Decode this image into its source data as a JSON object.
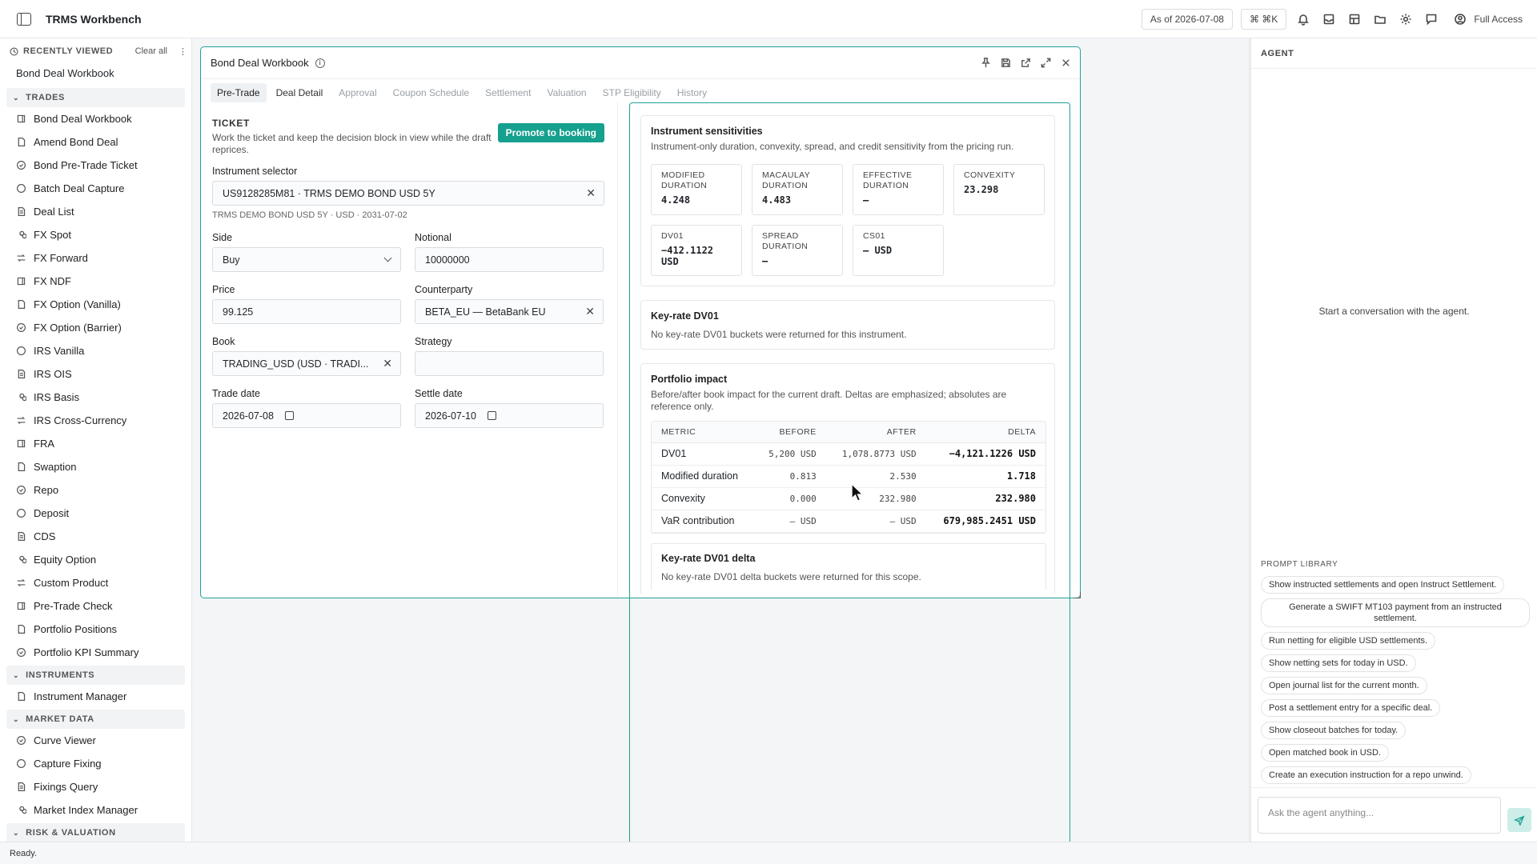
{
  "app": {
    "title": "TRMS Workbench"
  },
  "topbar": {
    "as_of": "As of 2026-07-08",
    "shortcut": "⌘ ⌘K",
    "access": "Full Access"
  },
  "sidebar": {
    "recent_label": "RECENTLY VIEWED",
    "clear_all": "Clear all",
    "recent_items": [
      "Bond Deal Workbook"
    ],
    "sections": [
      {
        "label": "TRADES",
        "items": [
          "Bond Deal Workbook",
          "Amend Bond Deal",
          "Bond Pre-Trade Ticket",
          "Batch Deal Capture",
          "Deal List",
          "FX Spot",
          "FX Forward",
          "FX NDF",
          "FX Option (Vanilla)",
          "FX Option (Barrier)",
          "IRS Vanilla",
          "IRS OIS",
          "IRS Basis",
          "IRS Cross-Currency",
          "FRA",
          "Swaption",
          "Repo",
          "Deposit",
          "CDS",
          "Equity Option",
          "Custom Product",
          "Pre-Trade Check",
          "Portfolio Positions",
          "Portfolio KPI Summary"
        ]
      },
      {
        "label": "INSTRUMENTS",
        "items": [
          "Instrument Manager"
        ]
      },
      {
        "label": "MARKET DATA",
        "items": [
          "Curve Viewer",
          "Capture Fixing",
          "Fixings Query",
          "Market Index Manager"
        ]
      },
      {
        "label": "RISK & VALUATION",
        "items": []
      }
    ]
  },
  "window": {
    "title": "Bond Deal Workbook",
    "tabs": [
      "Pre-Trade",
      "Deal Detail",
      "Approval",
      "Coupon Schedule",
      "Settlement",
      "Valuation",
      "STP Eligibility",
      "History"
    ]
  },
  "ticket": {
    "title": "TICKET",
    "desc": "Work the ticket and keep the decision block in view while the draft reprices.",
    "promote": "Promote to booking",
    "instrument_label": "Instrument selector",
    "instrument_value": "US9128285M81 · TRMS DEMO BOND USD 5Y",
    "instrument_hint": "TRMS DEMO BOND USD 5Y · USD · 2031-07-02",
    "side_label": "Side",
    "side_value": "Buy",
    "notional_label": "Notional",
    "notional_value": "10000000",
    "price_label": "Price",
    "price_value": "99.125",
    "counterparty_label": "Counterparty",
    "counterparty_value": "BETA_EU — BetaBank EU",
    "book_label": "Book",
    "book_value": "TRADING_USD (USD · TRADI...",
    "strategy_label": "Strategy",
    "strategy_value": "",
    "trade_date_label": "Trade date",
    "trade_date_value": "2026-07-08",
    "settle_date_label": "Settle date",
    "settle_date_value": "2026-07-10"
  },
  "sensitivities": {
    "title": "Instrument sensitivities",
    "sub": "Instrument-only duration, convexity, spread, and credit sensitivity from the pricing run.",
    "metrics": [
      {
        "label": "MODIFIED DURATION",
        "value": "4.248"
      },
      {
        "label": "MACAULAY DURATION",
        "value": "4.483"
      },
      {
        "label": "EFFECTIVE DURATION",
        "value": "—"
      },
      {
        "label": "CONVEXITY",
        "value": "23.298"
      },
      {
        "label": "DV01",
        "value": "−412.1122 USD"
      },
      {
        "label": "SPREAD DURATION",
        "value": "—"
      },
      {
        "label": "CS01",
        "value": "— USD"
      }
    ]
  },
  "keyrate": {
    "title": "Key-rate DV01",
    "sub": "No key-rate DV01 buckets were returned for this instrument."
  },
  "impact": {
    "title": "Portfolio impact",
    "sub": "Before/after book impact for the current draft. Deltas are emphasized; absolutes are reference only.",
    "headers": [
      "METRIC",
      "BEFORE",
      "AFTER",
      "DELTA"
    ],
    "rows": [
      [
        "DV01",
        "5,200 USD",
        "1,078.8773 USD",
        "−4,121.1226 USD"
      ],
      [
        "Modified duration",
        "0.813",
        "2.530",
        "1.718"
      ],
      [
        "Convexity",
        "0.000",
        "232.980",
        "232.980"
      ],
      [
        "VaR contribution",
        "— USD",
        "— USD",
        "679,985.2451 USD"
      ]
    ]
  },
  "keyrate_delta": {
    "title": "Key-rate DV01 delta",
    "sub": "No key-rate DV01 delta buckets were returned for this scope."
  },
  "agent": {
    "title": "AGENT",
    "empty": "Start a conversation with the agent.",
    "library_label": "PROMPT LIBRARY",
    "prompts": [
      "Show instructed settlements and open Instruct Settlement.",
      "Generate a SWIFT MT103 payment from an instructed settlement.",
      "Run netting for eligible USD settlements.",
      "Show netting sets for today in USD.",
      "Open journal list for the current month.",
      "Post a settlement entry for a specific deal.",
      "Show closeout batches for today.",
      "Open matched book in USD.",
      "Create an execution instruction for a repo unwind."
    ],
    "input_placeholder": "Ask the agent anything..."
  },
  "status": {
    "text": "Ready."
  }
}
